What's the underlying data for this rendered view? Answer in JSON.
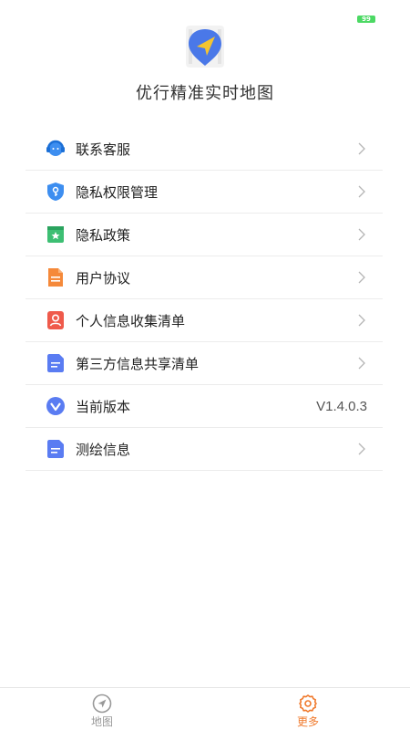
{
  "status_bar": {
    "battery": "99"
  },
  "app": {
    "title": "优行精准实时地图",
    "logo_icon": "map-navigation-logo-icon"
  },
  "menu": {
    "items": [
      {
        "label": "联系客服",
        "icon": "customer-service-icon",
        "color": "#3d8ef0"
      },
      {
        "label": "隐私权限管理",
        "icon": "shield-key-icon",
        "color": "#3d8ef0"
      },
      {
        "label": "隐私政策",
        "icon": "bookmark-star-icon",
        "color": "#3dbf73"
      },
      {
        "label": "用户协议",
        "icon": "document-icon",
        "color": "#f5893a"
      },
      {
        "label": "个人信息收集清单",
        "icon": "person-card-icon",
        "color": "#ef5a4b"
      },
      {
        "label": "第三方信息共享清单",
        "icon": "document-lines-icon",
        "color": "#5a7cf2"
      },
      {
        "label": "当前版本",
        "icon": "version-check-icon",
        "color": "#5a7cf2",
        "value": "V1.4.0.3"
      },
      {
        "label": "测绘信息",
        "icon": "document-lines-icon",
        "color": "#5a7cf2"
      }
    ]
  },
  "tabbar": {
    "tabs": [
      {
        "label": "地图",
        "icon": "navigation-arrow-icon",
        "active": false
      },
      {
        "label": "更多",
        "icon": "gear-icon",
        "active": true
      }
    ],
    "active_color": "#f07a2d",
    "inactive_color": "#999999"
  }
}
